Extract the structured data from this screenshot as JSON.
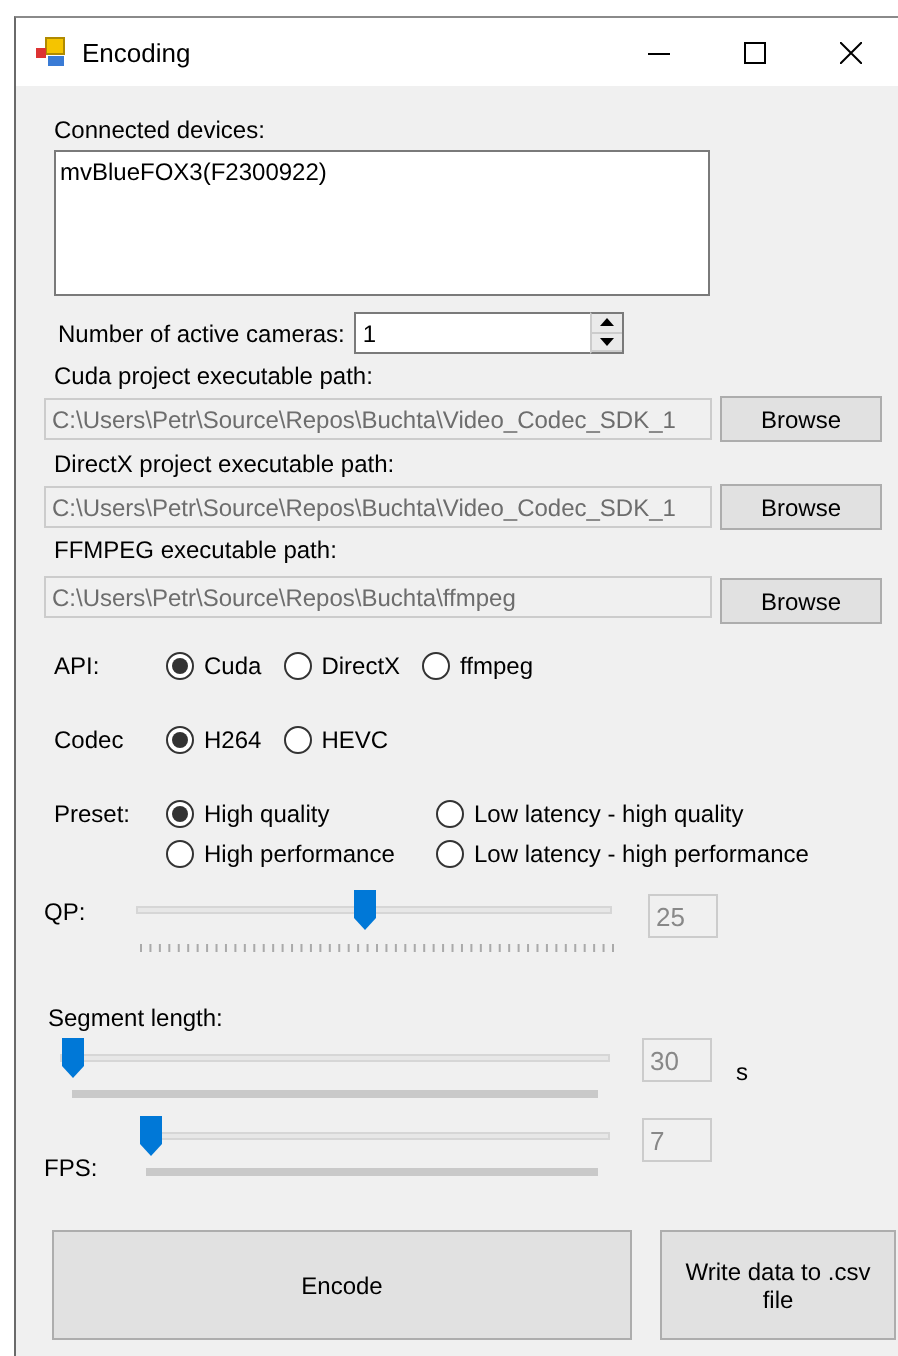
{
  "window": {
    "title": "Encoding"
  },
  "devices": {
    "label": "Connected devices:",
    "items": [
      "mvBlueFOX3(F2300922)"
    ]
  },
  "cameras": {
    "label": "Number of active cameras:",
    "value": "1"
  },
  "paths": [
    {
      "label": "Cuda project executable path:",
      "value": "C:\\Users\\Petr\\Source\\Repos\\Buchta\\Video_Codec_SDK_1",
      "disabled": true,
      "button": "Browse"
    },
    {
      "label": "DirectX project executable path:",
      "value": "C:\\Users\\Petr\\Source\\Repos\\Buchta\\Video_Codec_SDK_1",
      "disabled": true,
      "button": "Browse"
    },
    {
      "label": "FFMPEG executable path:",
      "value": "C:\\Users\\Petr\\Source\\Repos\\Buchta\\ffmpeg",
      "disabled": true,
      "button": "Browse"
    }
  ],
  "radio_groups": [
    {
      "label": "API:",
      "options": [
        {
          "label": "Cuda",
          "selected": true
        },
        {
          "label": "DirectX",
          "selected": false
        },
        {
          "label": "ffmpeg",
          "selected": false
        }
      ]
    },
    {
      "label": "Codec",
      "options": [
        {
          "label": "H264",
          "selected": true
        },
        {
          "label": "HEVC",
          "selected": false
        }
      ]
    },
    {
      "label": "Preset:",
      "options": [
        {
          "label": "High quality",
          "selected": true
        },
        {
          "label": "Low latency - high quality",
          "selected": false
        },
        {
          "label": "High performance",
          "selected": false
        },
        {
          "label": "Low latency - high performance",
          "selected": false
        }
      ]
    }
  ],
  "sliders": [
    {
      "kind": "ticked",
      "label": "QP:",
      "level": 0.48,
      "value": "25",
      "disabled": true
    },
    {
      "kind": "label_above",
      "label": "Segment length:",
      "level": 0.02,
      "value": "30",
      "disabled": true,
      "unit": "s"
    },
    {
      "kind": "label_below",
      "label": "FPS:",
      "level": 0.02,
      "value": "7",
      "disabled": true
    }
  ],
  "buttons": [
    "Encode",
    "Write data to .csv file"
  ]
}
